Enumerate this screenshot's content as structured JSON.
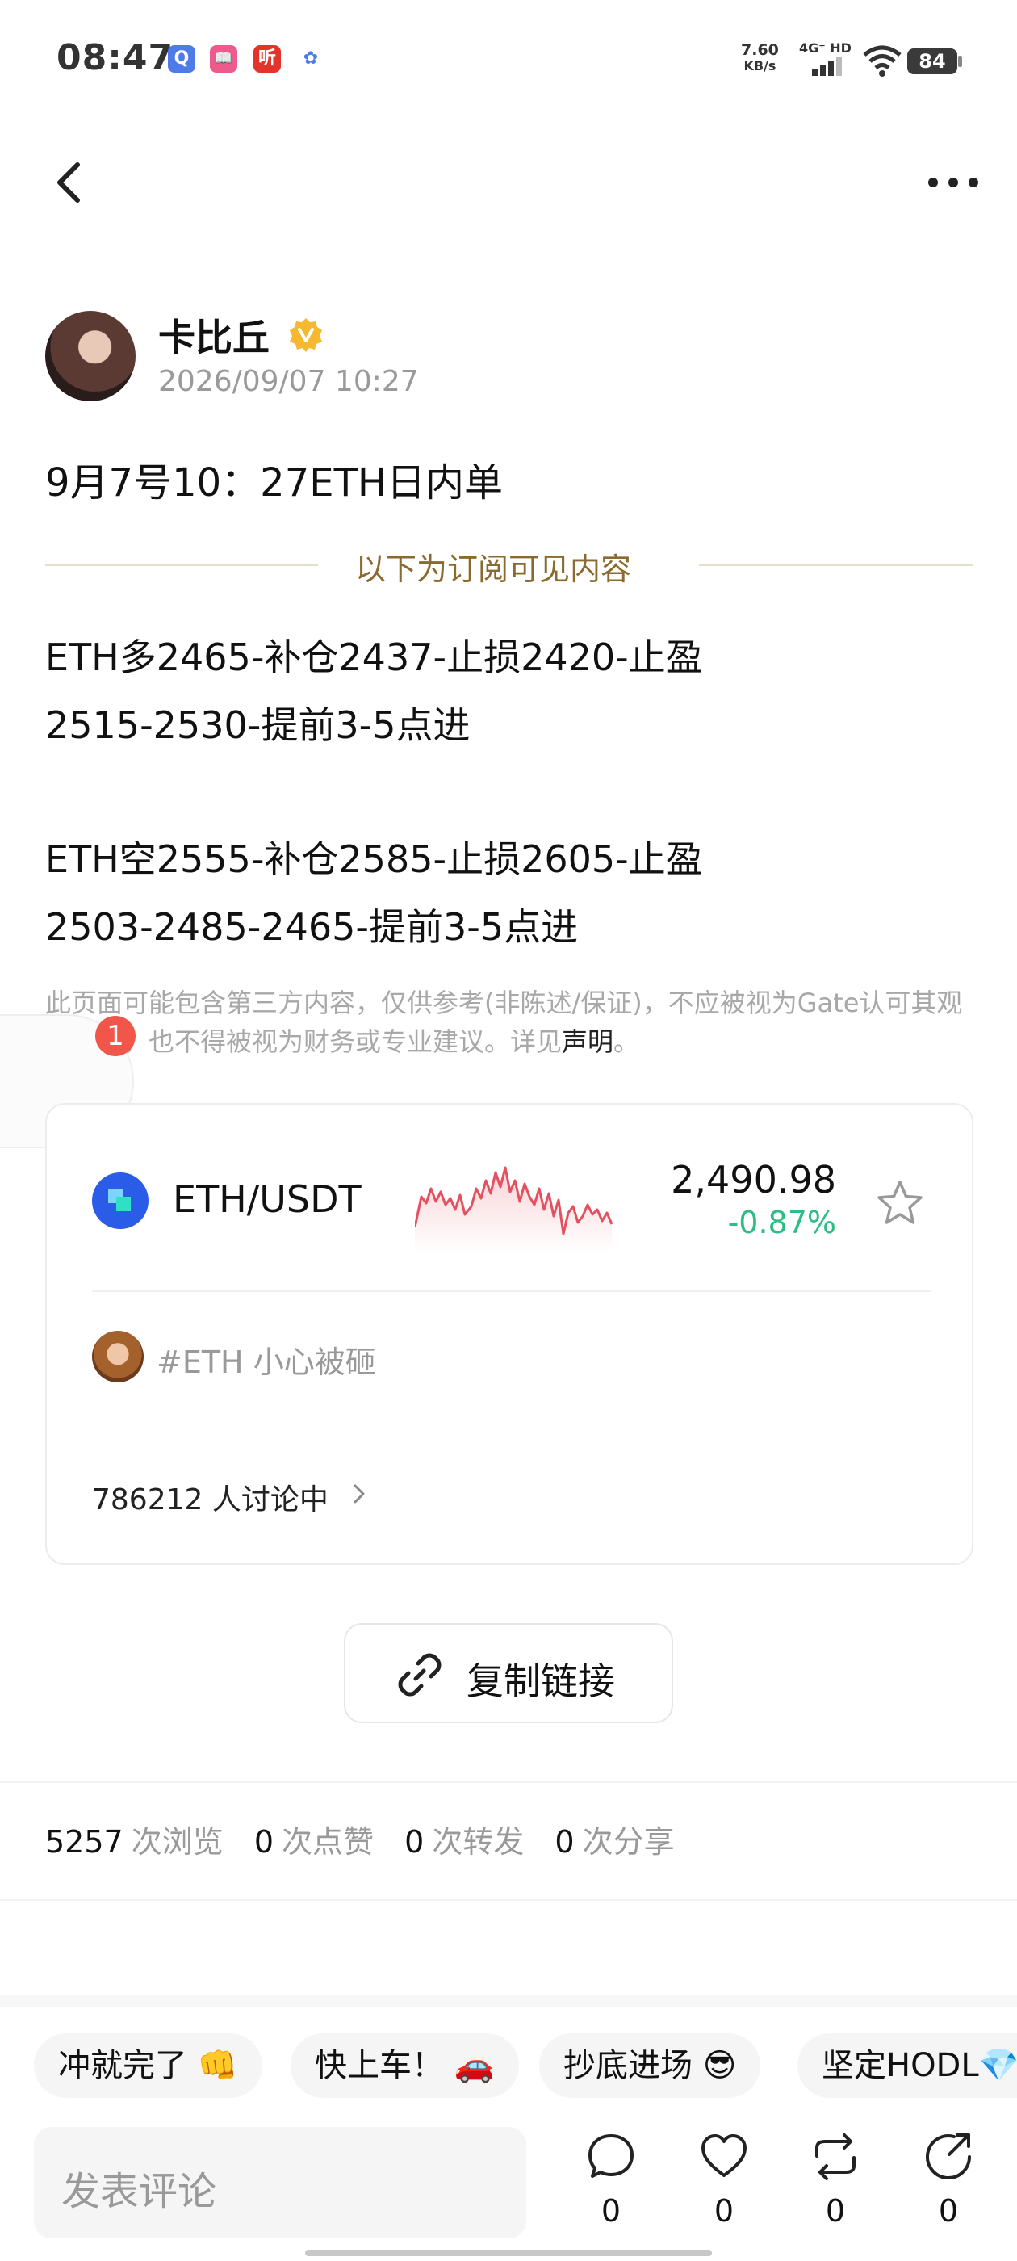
{
  "status_bar": {
    "time": "08:47",
    "app_icons": [
      "Q",
      "📖",
      "听",
      "✿"
    ],
    "net_speed_value": "7.60",
    "net_speed_unit": "KB/s",
    "net_type": "4G⁺ HD",
    "battery": "84"
  },
  "author": {
    "name": "卡比丘",
    "verified_badge": "V",
    "timestamp": "2026/09/07 10:27"
  },
  "post": {
    "title": "9月7号10：27ETH日内单",
    "subscriber_divider": "以下为订阅可见内容",
    "lines": [
      "ETH多2465-补仓2437-止损2420-止盈",
      "2515-2530-提前3-5点进",
      "ETH空2555-补仓2585-止损2605-止盈",
      "2503-2485-2465-提前3-5点进"
    ],
    "disclaimer": "此页面可能包含第三方内容，仅供参考(非陈述/保证)，不应被视为Gate认可其观点表述，也不得被视为财务或专业建议。详见",
    "disclaimer_link": "声明",
    "disclaimer_end": "。",
    "float_badge": "1"
  },
  "market_card": {
    "pair": "ETH/USDT",
    "price": "2,490.98",
    "change": "-0.87%",
    "topic": "#ETH 小心被砸",
    "discussion": "786212 人讨论中"
  },
  "copy_link": "复制链接",
  "stats": {
    "views": "5257",
    "views_label": "次浏览",
    "likes": "0",
    "likes_label": "次点赞",
    "reposts": "0",
    "reposts_label": "次转发",
    "shares": "0",
    "shares_label": "次分享"
  },
  "quick_replies": [
    "冲就完了 👊",
    "快上车！ 🚗",
    "抄底进场 😎",
    "坚定HODL💎"
  ],
  "bottom_bar": {
    "comment_placeholder": "发表评论",
    "comment_count": "0",
    "like_count": "0",
    "repost_count": "0",
    "share_count": "0"
  },
  "colors": {
    "accent_gold": "#8a6a2e",
    "positive_green": "#2ebd85",
    "sparkline_red": "#e5505f",
    "badge_red": "#f2564b",
    "verified_yellow": "#f5b82e",
    "coin_blue": "#2a5ce8"
  },
  "icons": {
    "back": "chevron-left-icon",
    "more": "more-horizontal-icon",
    "verified": "verified-badge-icon",
    "star": "star-icon",
    "link": "link-icon",
    "comment": "comment-icon",
    "like": "heart-icon",
    "repost": "repost-icon",
    "share": "share-icon"
  }
}
